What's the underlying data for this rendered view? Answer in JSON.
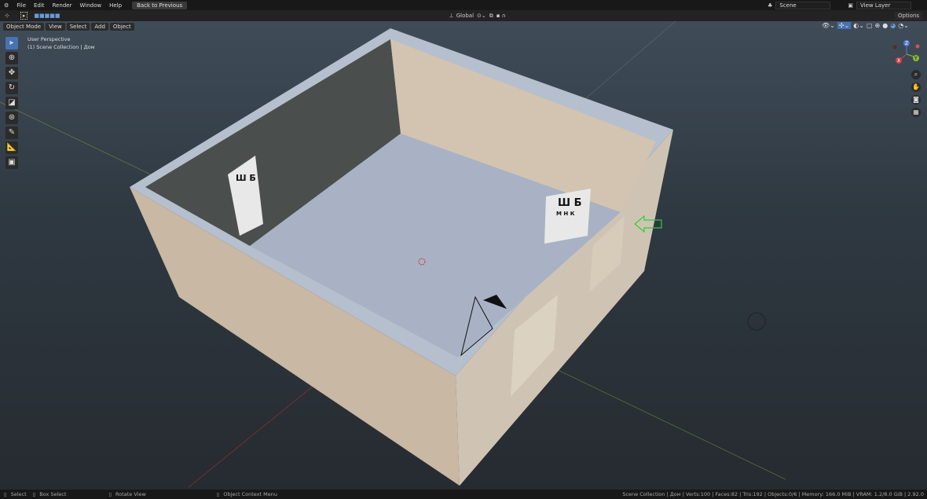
{
  "topbar": {
    "menus": [
      "File",
      "Edit",
      "Render",
      "Window",
      "Help"
    ],
    "back_button": "Back to Previous",
    "scene": "Scene",
    "view_layer": "View Layer"
  },
  "header": {
    "orientation": "Global",
    "options": "Options"
  },
  "viewport_header": {
    "mode": "Object Mode",
    "menus": [
      "View",
      "Select",
      "Add",
      "Object"
    ]
  },
  "overlay": {
    "perspective": "User Perspective",
    "collection": "(1) Scene Collection | Дом"
  },
  "gizmo": {
    "z": "Z",
    "y": "Y",
    "x": "X"
  },
  "eye_chart": {
    "row1": "Ш Б",
    "row2": "М Н К"
  },
  "status": {
    "select": "Select",
    "box_select": "Box Select",
    "rotate": "Rotate View",
    "context": "Object Context Menu",
    "stats": "Scene Collection | Дом | Verts:100 | Faces:82 | Tris:192 | Objects:0/6 | Memory: 166.0 MiB | VRAM: 1.2/8.0 GiB | 2.92.0"
  }
}
